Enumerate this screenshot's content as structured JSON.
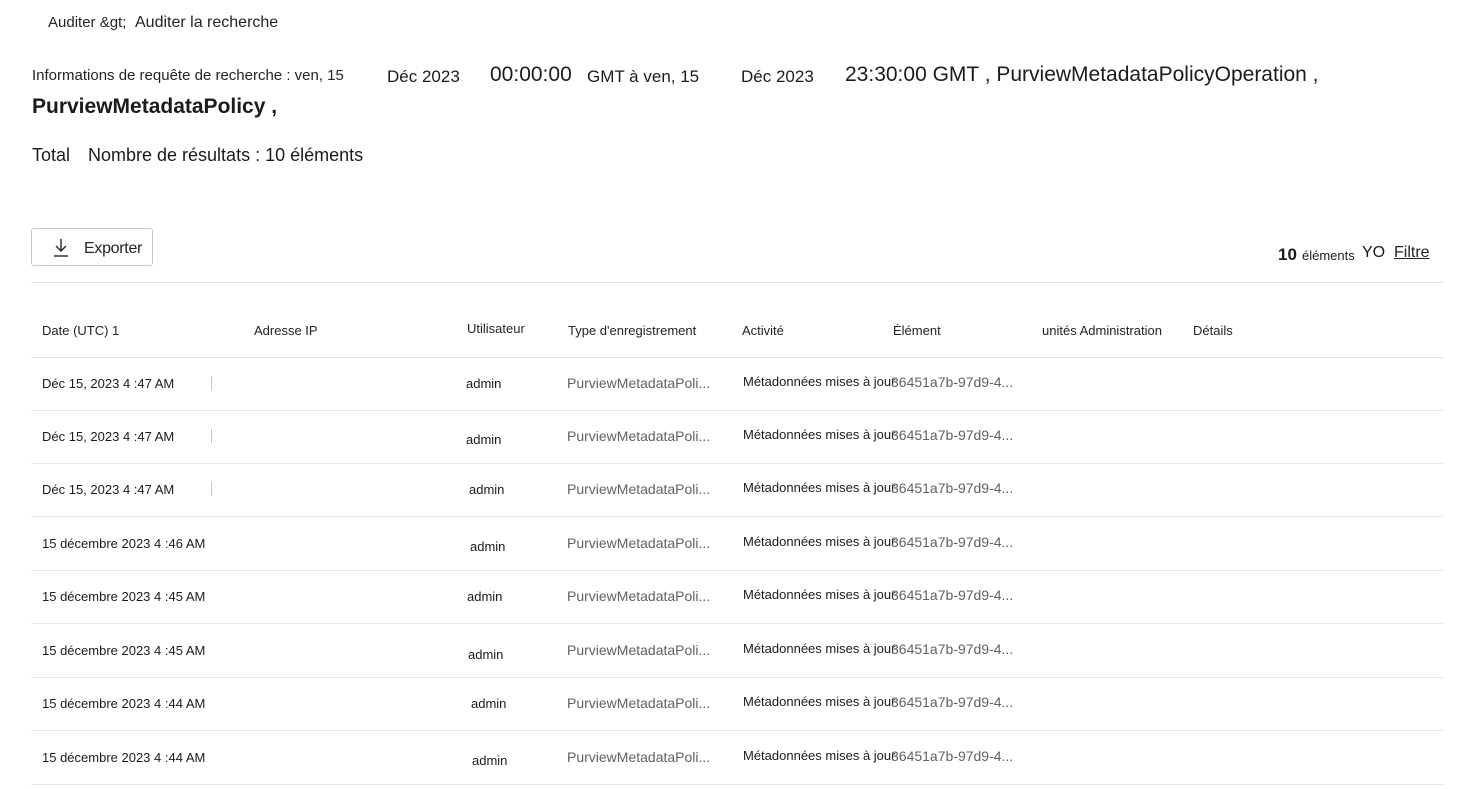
{
  "breadcrumb": {
    "parent": "Auditer &gt;",
    "current": "Auditer la recherche"
  },
  "query": {
    "label": "Informations de requête de recherche : ven, 15",
    "start_month": "Déc 2023",
    "start_time": "00:00:00",
    "start_tz_to": "GMT à ven, 15",
    "end_month": "Déc 2023",
    "end_time": "23:30:00 GMT , PurviewMetadataPolicyOperation ,",
    "policy": "PurviewMetadataPolicy ,"
  },
  "total": {
    "label": "Total",
    "text": "Nombre de résultats : 10 éléments"
  },
  "toolbar": {
    "export_label": "Exporter",
    "count_number": "10",
    "count_unit": "éléments",
    "yo": "YO",
    "filter_label": "Filtre"
  },
  "table": {
    "headers": {
      "date": "Date (UTC) 1",
      "ip": "Adresse IP",
      "user": "Utilisateur",
      "record_type": "Type d'enregistrement",
      "activity": "Activité",
      "item": "Élément",
      "admin_units": "unités Administration",
      "details": "Détails"
    },
    "rows": [
      {
        "date": "Déc 15, 2023 4 :47 AM",
        "user": "admin",
        "record_type": "PurviewMetadataPoli...",
        "activity": "Métadonnées mises à jour",
        "item": "36451a7b-97d9-4..."
      },
      {
        "date": "Déc 15, 2023 4 :47 AM",
        "user": "admin",
        "record_type": "PurviewMetadataPoli...",
        "activity": "Métadonnées mises à jour",
        "item": "36451a7b-97d9-4..."
      },
      {
        "date": "Déc 15, 2023 4 :47 AM",
        "user": "admin",
        "record_type": "PurviewMetadataPoli...",
        "activity": "Métadonnées mises à jour",
        "item": "36451a7b-97d9-4..."
      },
      {
        "date": "15 décembre 2023 4 :46 AM",
        "user": "admin",
        "record_type": "PurviewMetadataPoli...",
        "activity": "Métadonnées mises à jour",
        "item": "36451a7b-97d9-4..."
      },
      {
        "date": "15 décembre 2023 4 :45 AM",
        "user": "admin",
        "record_type": "PurviewMetadataPoli...",
        "activity": "Métadonnées mises à jour",
        "item": "36451a7b-97d9-4..."
      },
      {
        "date": "15 décembre 2023 4 :45 AM",
        "user": "admin",
        "record_type": "PurviewMetadataPoli...",
        "activity": "Métadonnées mises à jour",
        "item": "36451a7b-97d9-4..."
      },
      {
        "date": "15 décembre 2023 4 :44 AM",
        "user": "admin",
        "record_type": "PurviewMetadataPoli...",
        "activity": "Métadonnées mises à jour",
        "item": "36451a7b-97d9-4..."
      },
      {
        "date": "15 décembre 2023 4 :44 AM",
        "user": "admin",
        "record_type": "PurviewMetadataPoli...",
        "activity": "Métadonnées mises à jour",
        "item": "36451a7b-97d9-4..."
      }
    ]
  },
  "icons": {
    "export": "download-icon"
  }
}
